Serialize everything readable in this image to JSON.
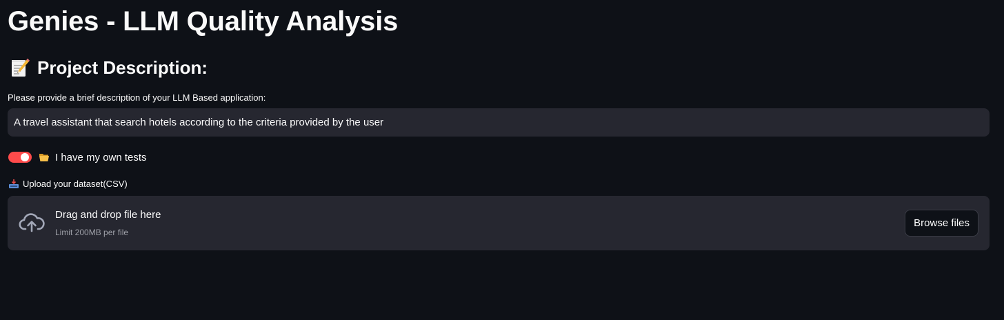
{
  "app": {
    "title": "Genies - LLM Quality Analysis"
  },
  "project": {
    "heading_icon": "memo-icon",
    "heading": "Project Description:",
    "description_label": "Please provide a brief description of your LLM Based application:",
    "description_value": "A travel assistant that search hotels according to the criteria provided by the user",
    "description_placeholder": ""
  },
  "own_tests": {
    "toggle_on": true,
    "icon": "open-folder-icon",
    "label": "I have my own tests"
  },
  "upload": {
    "icon": "inbox-tray-icon",
    "label": "Upload your dataset(CSV)",
    "dropzone_icon": "cloud-upload-icon",
    "dropzone_title": "Drag and drop file here",
    "dropzone_limit": "Limit 200MB per file",
    "browse_label": "Browse files"
  },
  "colors": {
    "background": "#0e1117",
    "surface": "#262730",
    "accent": "#ff4b4b",
    "text": "#fafafa",
    "muted_text": "#9ea0a8"
  }
}
